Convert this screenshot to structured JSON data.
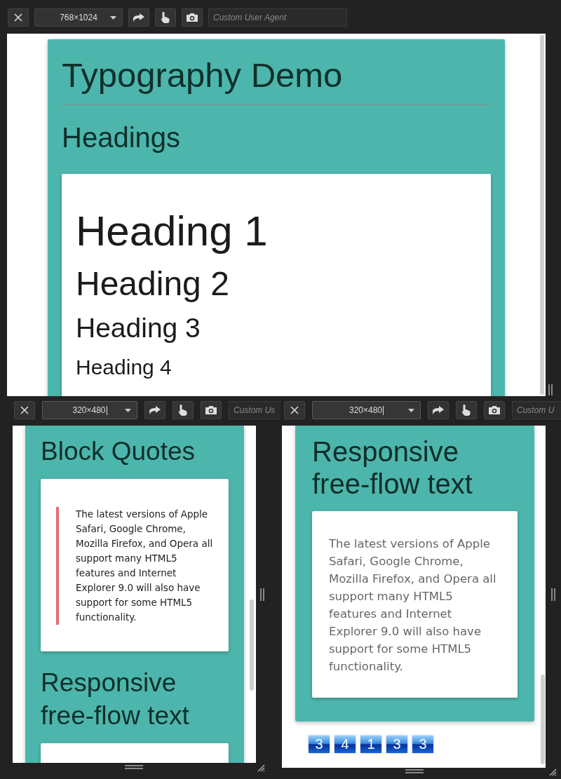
{
  "panes": [
    {
      "toolbar": {
        "size": "768×1024",
        "size_focused": false,
        "user_agent_placeholder": "Custom User Agent"
      },
      "blocks": [
        {
          "kind": "title",
          "text": "Typography Demo"
        },
        {
          "kind": "rule"
        },
        {
          "kind": "section_heading",
          "text": "Headings"
        },
        {
          "kind": "headings_card",
          "headings": [
            "Heading 1",
            "Heading 2",
            "Heading 3",
            "Heading 4"
          ]
        }
      ]
    },
    {
      "toolbar": {
        "size": "320×480",
        "size_focused": true,
        "user_agent_placeholder": "Custom Us"
      },
      "blocks": [
        {
          "kind": "section_heading",
          "text": "Block Quotes"
        },
        {
          "kind": "quote_card",
          "text": "The latest versions of Apple Safari, Google Chrome, Mozilla Firefox, and Opera all support many HTML5 features and Internet Explorer 9.0 will also have support for some HTML5 functionality."
        },
        {
          "kind": "section_heading",
          "text": "Responsive free-flow text"
        },
        {
          "kind": "empty_card"
        }
      ]
    },
    {
      "toolbar": {
        "size": "320×480",
        "size_focused": true,
        "user_agent_placeholder": "Custom U"
      },
      "blocks": [
        {
          "kind": "section_heading",
          "text": "Responsive free-flow text"
        },
        {
          "kind": "text_card",
          "text": "The latest versions of Apple Safari, Google Chrome, Mozilla Firefox, and Opera all support many HTML5 features and Internet Explorer 9.0 will also have support for some HTML5 functionality."
        }
      ],
      "badges": [
        "3",
        "4",
        "1",
        "3",
        "3"
      ]
    }
  ]
}
